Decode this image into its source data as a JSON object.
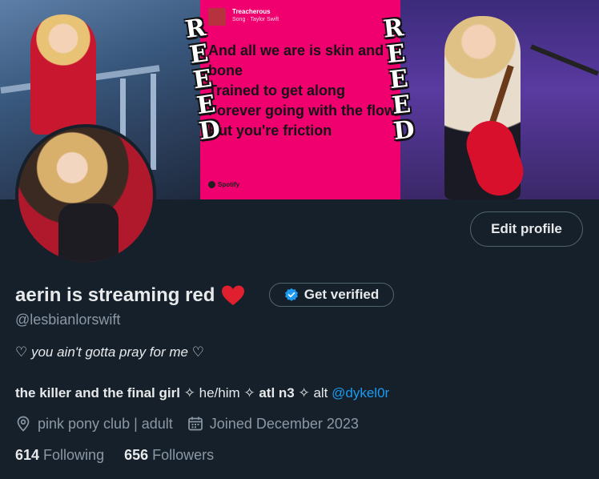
{
  "banner": {
    "song_title": "Treacherous",
    "song_subtitle": "Song · Taylor Swift",
    "lyrics": "And all we are is skin and bone\nTrained to get along\nForever going with the flow\nBut you're friction",
    "spotify_label": "Spotify",
    "sticker_letters": [
      "R",
      "E",
      "E",
      "E",
      "D"
    ],
    "accent_color": "#f0006e"
  },
  "profile": {
    "display_name": "aerin is streaming red",
    "name_emoji": "red-heart",
    "get_verified_label": "Get verified",
    "edit_profile_label": "Edit profile",
    "handle": "@lesbianlorswift",
    "bio_quote": "♡ you ain't gotta pray for me ♡",
    "bio_line": {
      "part1": "the killer and the final girl",
      "sep1": " ✧ he/him ✧ ",
      "part2": "atl n3",
      "sep2": " ✧ alt ",
      "link": "@dykel0r"
    },
    "location": "pink pony club | adult",
    "joined": "Joined December 2023",
    "following_count": "614",
    "following_label": "Following",
    "followers_count": "656",
    "followers_label": "Followers"
  },
  "colors": {
    "background": "#15202b",
    "link": "#1d9bf0",
    "muted": "#8b98a5",
    "text": "#e7e9ea",
    "verified_badge": "#1d9bf0",
    "heart": "#e0202e"
  }
}
